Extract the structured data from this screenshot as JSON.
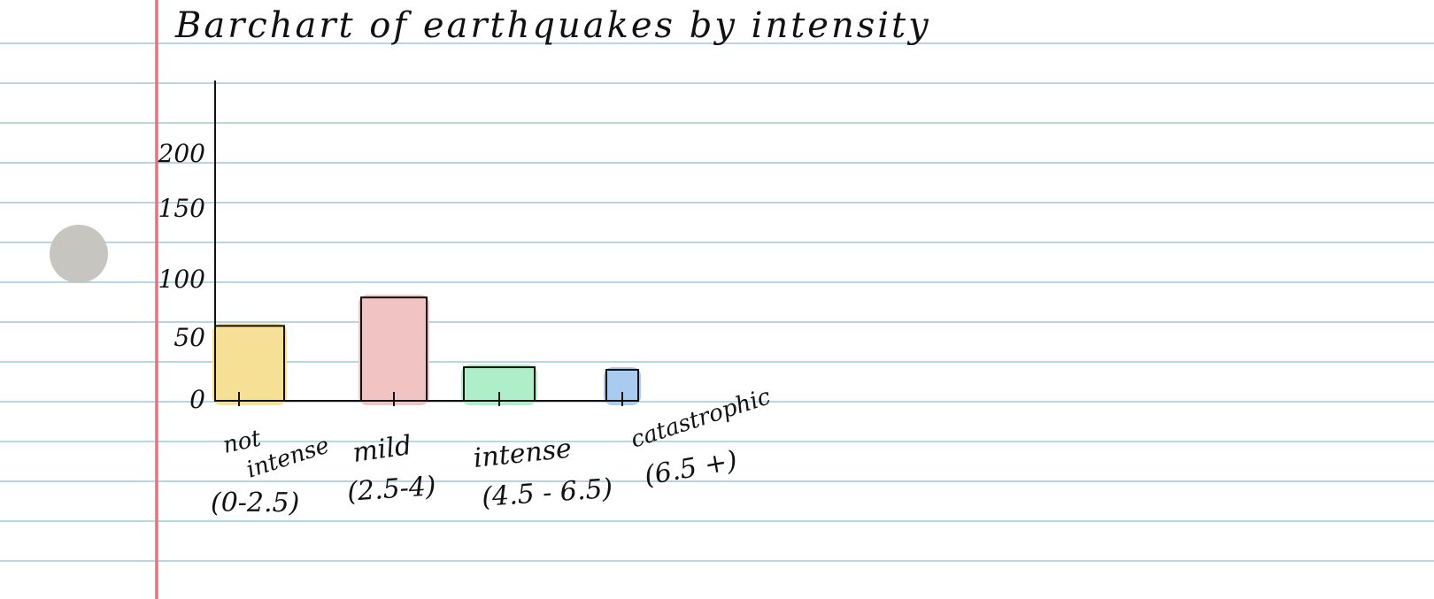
{
  "page": {
    "title": "Barchart of earthquakes by intensity"
  },
  "colors": {
    "paper": "#ffffff",
    "rule_line": "#b7d6e2",
    "margin_line": "#e0767d",
    "punch_hole": "#c7c5c0",
    "ink": "#111111"
  },
  "icons": {
    "punch_hole": "circle"
  },
  "chart_data": {
    "type": "bar",
    "title": "Barchart of earthquakes by intensity",
    "xlabel": "",
    "ylabel": "",
    "yticks": [
      "0",
      "50",
      "100",
      "150",
      "200"
    ],
    "ylim": [
      0,
      200
    ],
    "grid": false,
    "categories": [
      [
        "not",
        "intense",
        "(0-2.5)"
      ],
      [
        "mild",
        "(2.5-4)"
      ],
      [
        "intense",
        "(4.5 - 6.5)"
      ],
      [
        "catastrophic",
        "(6.5 +)"
      ]
    ],
    "values": [
      58,
      80,
      26,
      24
    ],
    "bar_colors": [
      "#f5e096",
      "#f2c3c3",
      "#aeeec8",
      "#a9cbef"
    ]
  }
}
